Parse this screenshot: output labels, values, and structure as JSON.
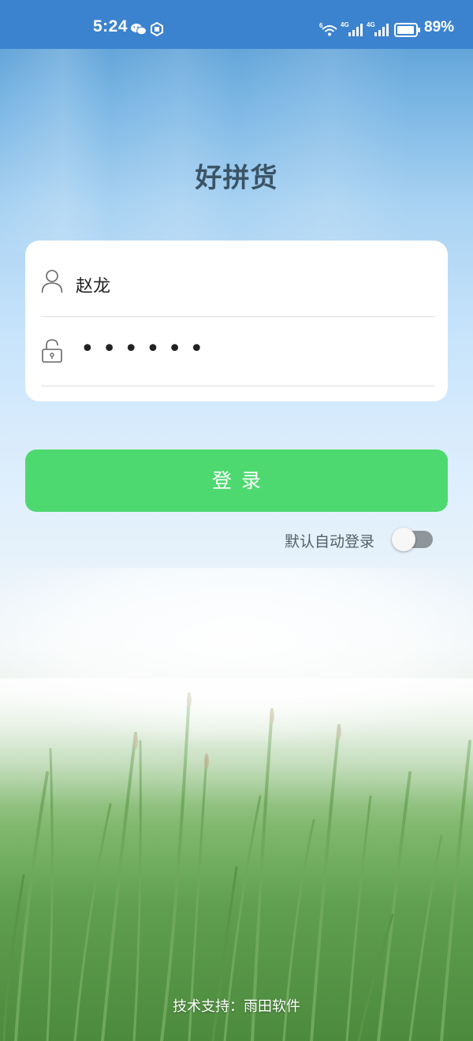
{
  "status_bar": {
    "time": "5:24",
    "battery_percent": "89%",
    "notification_icons": [
      "wechat-icon",
      "app-notification-icon"
    ],
    "system_icons": [
      "wifi-icon",
      "signal-4g-icon",
      "signal-4g-icon",
      "battery-icon"
    ]
  },
  "app": {
    "title": "好拼货"
  },
  "login_form": {
    "username": {
      "icon": "user-icon",
      "value": "赵龙"
    },
    "password": {
      "icon": "lock-icon",
      "masked_value": "••••••"
    }
  },
  "login_button": {
    "label": "登录"
  },
  "auto_login": {
    "label": "默认自动登录",
    "enabled": false
  },
  "footer": {
    "support_text": "技术支持：雨田软件"
  },
  "colors": {
    "status_bar": "#3b83cf",
    "login_button": "#4dd96f",
    "title": "#3a5466",
    "toggle_off_track": "#8e969c"
  }
}
